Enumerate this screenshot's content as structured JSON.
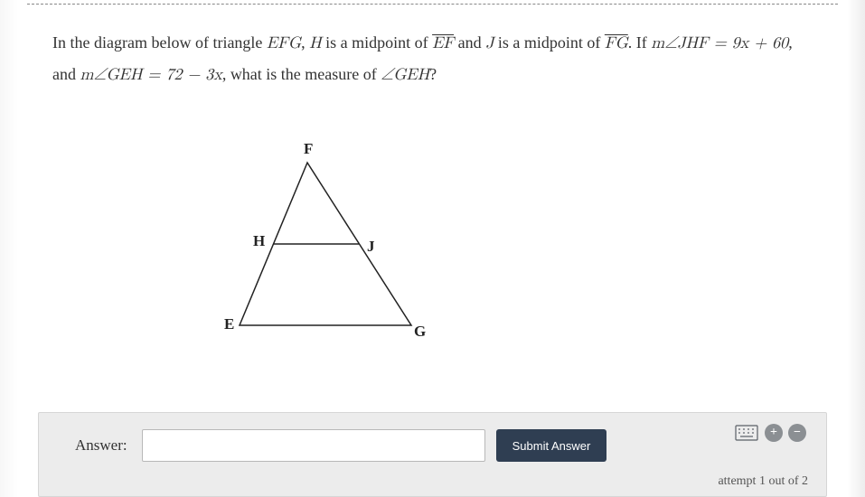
{
  "problem": {
    "text_part1": "In the diagram below of triangle ",
    "tri": "EFG",
    "text_part2": ", ",
    "H": "H",
    "text_part3": " is a midpoint of ",
    "seg1": "EF",
    "text_part4": " and ",
    "J": "J",
    "text_part5": " is a midpoint of ",
    "seg2": "FG",
    "text_part6": ". If ",
    "angle1_pre": "m∠JHF = ",
    "expr1": "9x + 60",
    "text_part7": ", and ",
    "angle2_pre": "m∠GEH = ",
    "expr2": "72 − 3x",
    "text_part8": ", what is the measure of ",
    "angle3_pre": "∠GEH",
    "text_part9": "?"
  },
  "diagram": {
    "F": "F",
    "H": "H",
    "J": "J",
    "E": "E",
    "G": "G"
  },
  "answer": {
    "label": "Answer:",
    "value": "",
    "submit": "Submit Answer",
    "attempt": "attempt 1 out of 2"
  },
  "icons": {
    "keyboard": "keyboard",
    "plus": "+",
    "minus": "−"
  }
}
